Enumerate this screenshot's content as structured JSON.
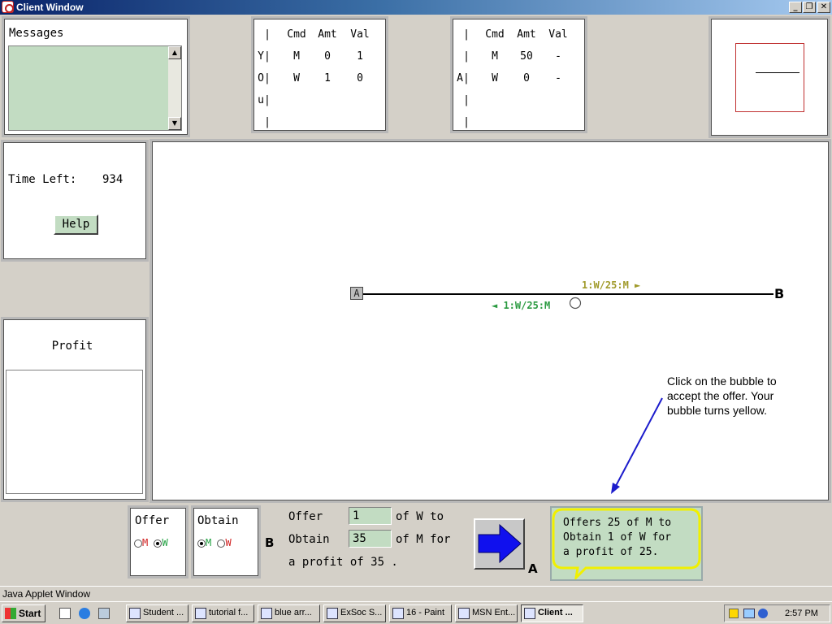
{
  "window": {
    "title": "Client Window",
    "minimize": "_",
    "restore": "❐",
    "close": "✕"
  },
  "messages": {
    "label": "Messages",
    "scroll_up": "▲",
    "scroll_down": "▼"
  },
  "you_table": {
    "side_label": [
      "",
      "Y|",
      "O|",
      "u|",
      "|"
    ],
    "headers": [
      "|",
      "Cmd",
      "Amt",
      "Val"
    ],
    "rows": [
      [
        "M",
        "0",
        "1"
      ],
      [
        "W",
        "1",
        "0"
      ]
    ]
  },
  "a_table": {
    "side_label": [
      "|",
      "|",
      "A|",
      "|",
      "|"
    ],
    "headers": [
      "Cmd",
      "Amt",
      "Val"
    ],
    "rows": [
      [
        "M",
        "50",
        "-"
      ],
      [
        "W",
        "0",
        "-"
      ]
    ]
  },
  "time": {
    "label": "Time Left:",
    "value": "934",
    "help": "Help"
  },
  "profit": {
    "label": "Profit"
  },
  "canvas": {
    "node_a": "A",
    "node_b": "B",
    "offer_up": "1:W/25:M ►",
    "offer_down": "◄ 1:W/25:M",
    "offer_up_color": "#a09a2a",
    "offer_down_color": "#2a9a40",
    "tutorial": [
      "Click on the bubble to",
      "accept the offer. Your",
      "bubble turns yellow."
    ],
    "arrow_color": "#1c1ccc"
  },
  "offer_box": {
    "label": "Offer",
    "opt1": "M",
    "opt2": "W",
    "selected": "W"
  },
  "obtain_box": {
    "label": "Obtain",
    "opt1": "M",
    "opt2": "W",
    "selected": "M"
  },
  "form": {
    "b_label": "B",
    "offer_label": "Offer",
    "offer_value": "1",
    "offer_suffix": "of W to",
    "obtain_label": "Obtain",
    "obtain_value": "35",
    "obtain_suffix": "of M for",
    "profit_line": "a profit of 35 .",
    "a_label": "A"
  },
  "bubble": {
    "lines": [
      "Offers 25 of M to",
      "Obtain 1 of W for",
      "a profit of 25."
    ],
    "border_color": "#f0f000",
    "fill": "#c2dcc2"
  },
  "status": "Java Applet Window",
  "taskbar": {
    "start": "Start",
    "tasks": [
      "Student ...",
      "tutorial f...",
      "blue arr...",
      "ExSoc S...",
      "16 - Paint",
      "MSN Ent...",
      "Client ..."
    ],
    "clock": "2:57 PM"
  }
}
